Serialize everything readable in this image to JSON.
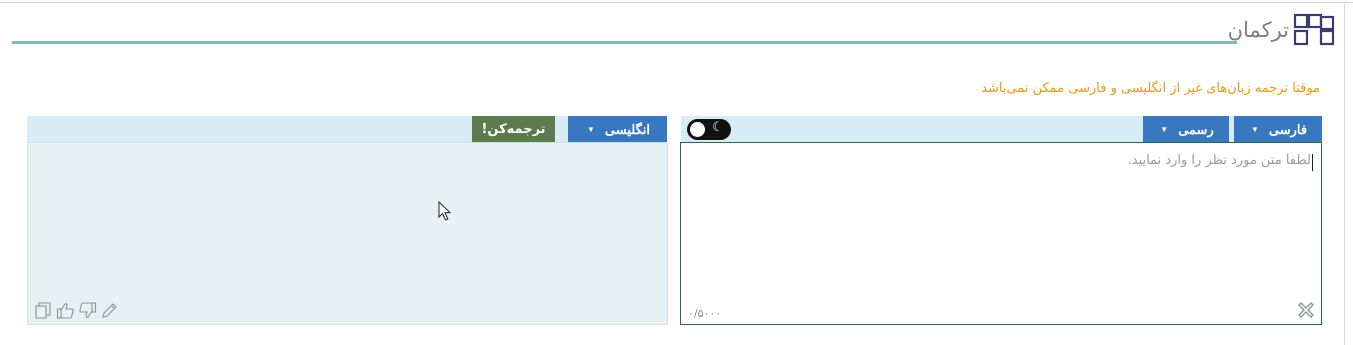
{
  "brand": {
    "name": "ترکمان",
    "logo_icon": "translate-logo-icon",
    "accent": "#3d3a72"
  },
  "notice": {
    "text": "موقتا ترجمه زبان‌های غیر از انگلیسی و فارسی ممکن نمی‌باشد",
    "color": "#e79a16"
  },
  "source": {
    "language": "فارسی",
    "style": "رسمی",
    "placeholder": "لطفا متن مورد نظر را وارد نمایید.",
    "value": "",
    "counter": "۰/۵۰۰۰",
    "theme_toggle_icon": "moon-icon",
    "clear_icon": "close-icon"
  },
  "target": {
    "language": "انگلیسی",
    "translate_label": "ترجمه‌کن!",
    "output": "",
    "tools": [
      "copy-icon",
      "thumbs-up-icon",
      "thumbs-down-icon",
      "edit-icon"
    ]
  },
  "colors": {
    "button_blue": "#3878c0",
    "translate_green": "#5c7c4e",
    "bar_bg": "#d6ecf6",
    "header_line": "#7fb6c0"
  }
}
